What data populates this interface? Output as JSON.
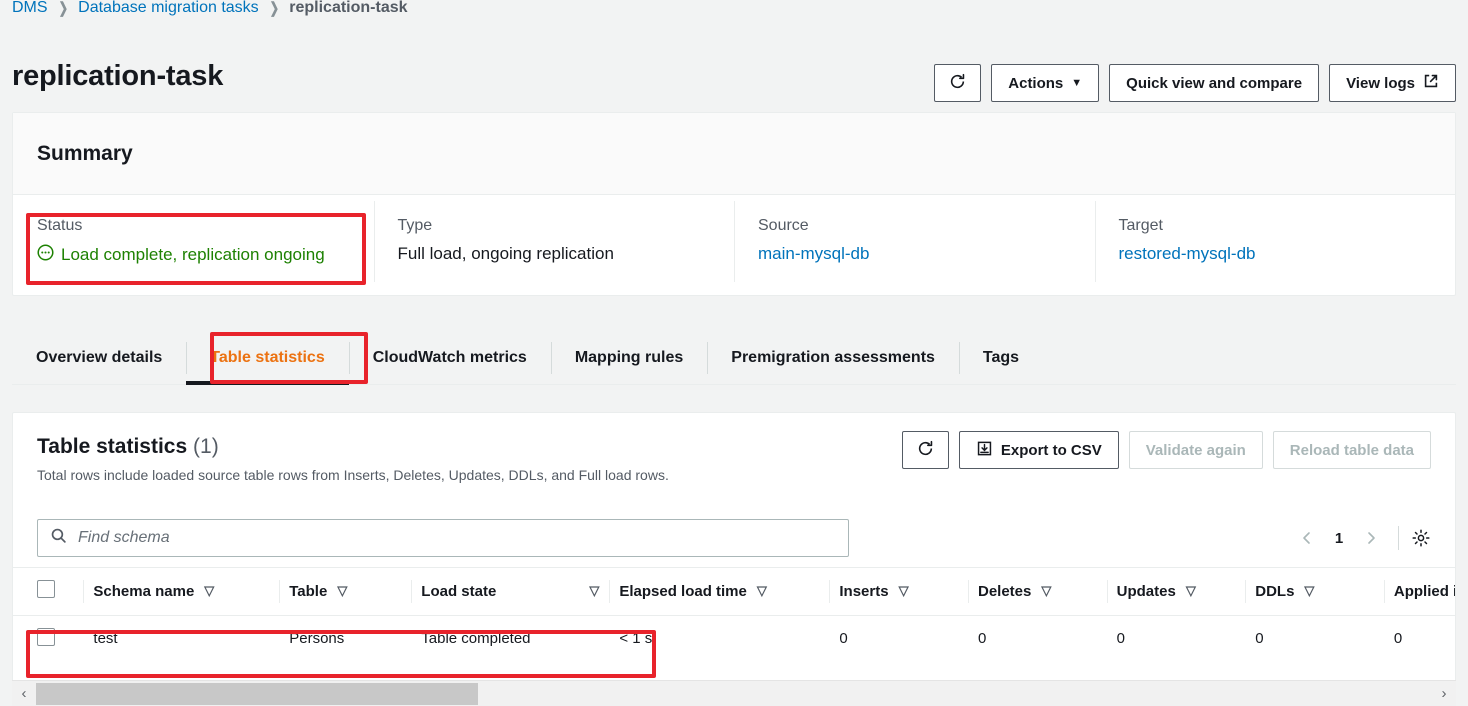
{
  "breadcrumb": {
    "items": [
      {
        "label": "DMS",
        "type": "link"
      },
      {
        "label": "Database migration tasks",
        "type": "link"
      },
      {
        "label": "replication-task",
        "type": "current"
      }
    ],
    "separator": "❯"
  },
  "header": {
    "title": "replication-task",
    "actions": {
      "refresh_icon": "refresh-icon",
      "actions_label": "Actions",
      "actions_caret": "▼",
      "quick_view_label": "Quick view and compare",
      "view_logs_label": "View logs",
      "view_logs_icon": "external-link-icon"
    }
  },
  "summary": {
    "heading": "Summary",
    "columns": [
      {
        "label": "Status",
        "value": "Load complete, replication ongoing",
        "icon": "status-in-progress-icon",
        "style": "status",
        "color": "#1d8102"
      },
      {
        "label": "Type",
        "value": "Full load, ongoing replication",
        "style": "text"
      },
      {
        "label": "Source",
        "value": "main-mysql-db",
        "style": "link"
      },
      {
        "label": "Target",
        "value": "restored-mysql-db",
        "style": "link"
      }
    ]
  },
  "tabs": {
    "items": [
      {
        "label": "Overview details",
        "active": false
      },
      {
        "label": "Table statistics",
        "active": true
      },
      {
        "label": "CloudWatch metrics",
        "active": false
      },
      {
        "label": "Mapping rules",
        "active": false
      },
      {
        "label": "Premigration assessments",
        "active": false
      },
      {
        "label": "Tags",
        "active": false
      }
    ],
    "active_color": "#ec7211"
  },
  "table_panel": {
    "title": "Table statistics",
    "count": "(1)",
    "description": "Total rows include loaded source table rows from Inserts, Deletes, Updates, DDLs, and Full load rows.",
    "actions": {
      "refresh_icon": "refresh-icon",
      "export_label": "Export to CSV",
      "export_icon": "download-icon",
      "validate_label": "Validate again",
      "validate_disabled": true,
      "reload_label": "Reload table data",
      "reload_disabled": true
    },
    "search": {
      "placeholder": "Find schema",
      "value": "",
      "icon": "search-icon"
    },
    "pagination": {
      "prev": "‹",
      "page": "1",
      "next": "›",
      "settings_icon": "gear-icon"
    },
    "columns": [
      {
        "key": "schema",
        "label": "Schema name",
        "sort": "▽"
      },
      {
        "key": "table",
        "label": "Table",
        "sort": "▽"
      },
      {
        "key": "load_state",
        "label": "Load state",
        "sort": "▽"
      },
      {
        "key": "elapsed",
        "label": "Elapsed load time",
        "sort": "▽"
      },
      {
        "key": "inserts",
        "label": "Inserts",
        "sort": "▽"
      },
      {
        "key": "deletes",
        "label": "Deletes",
        "sort": "▽"
      },
      {
        "key": "updates",
        "label": "Updates",
        "sort": "▽"
      },
      {
        "key": "ddls",
        "label": "DDLs",
        "sort": "▽"
      },
      {
        "key": "applied_inserts",
        "label": "Applied inserts",
        "sort": "▽"
      }
    ],
    "rows": [
      {
        "selected": false,
        "schema": "test",
        "table": "Persons",
        "load_state": "Table completed",
        "elapsed": "< 1 s",
        "inserts": "0",
        "deletes": "0",
        "updates": "0",
        "ddls": "0",
        "applied_inserts": "0"
      }
    ],
    "scrollbar": {
      "left_arrow": "‹",
      "right_arrow": "›"
    }
  },
  "annotations": {
    "color": "#e8232b",
    "boxes": [
      "status-field",
      "table-statistics-tab",
      "first-table-row"
    ]
  }
}
